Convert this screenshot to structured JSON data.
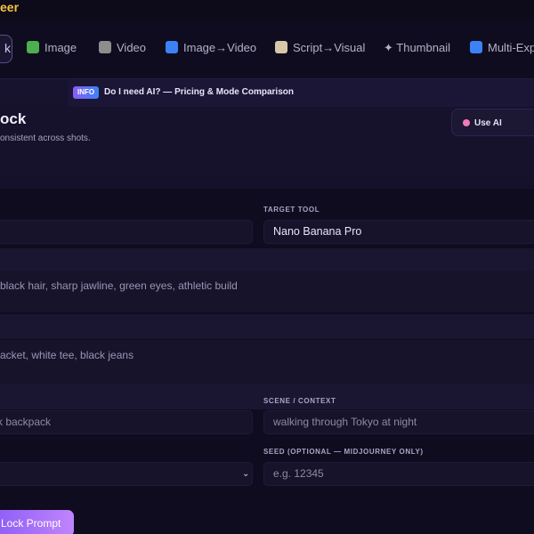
{
  "header": {
    "brand": "eer"
  },
  "tabs": [
    {
      "label": "Image",
      "icon": "image-icon",
      "color": "#4caf50"
    },
    {
      "label": "Video",
      "icon": "clapperboard-icon",
      "color": "#9e9e9e"
    },
    {
      "label": "Image→Video",
      "icon": "refresh-icon",
      "color": "#3b82f6"
    },
    {
      "label": "Script→Visual",
      "icon": "script-icon",
      "color": "#d7c9a8"
    },
    {
      "label": "✦ Thumbnail",
      "icon": "sparkle-icon",
      "color": "#cfc8ef"
    },
    {
      "label": "Multi-Expo",
      "icon": "shuffle-icon",
      "color": "#3b82f6"
    }
  ],
  "active_tab": {
    "symbol": "k"
  },
  "info": {
    "badge": "INFO",
    "text": "Do I need AI? — Pricing & Mode Comparison"
  },
  "page": {
    "title": "ock",
    "subtitle": "onsistent across shots."
  },
  "use_ai": {
    "label": "Use AI"
  },
  "form": {
    "target_tool_label": "TARGET TOOL",
    "target_tool_value": "Nano Banana Pro",
    "appearance_placeholder": "black hair, sharp jawline, green eyes, athletic build",
    "outfit_placeholder": "acket, white tee, black jeans",
    "accessory_placeholder": "ck backpack",
    "scene_label": "SCENE / CONTEXT",
    "scene_placeholder": "walking through Tokyo at night",
    "seed_label": "SEED (OPTIONAL — MIDJOURNEY ONLY)",
    "seed_placeholder": "e.g. 12345"
  },
  "actions": {
    "lock_prompt": "Lock Prompt"
  }
}
